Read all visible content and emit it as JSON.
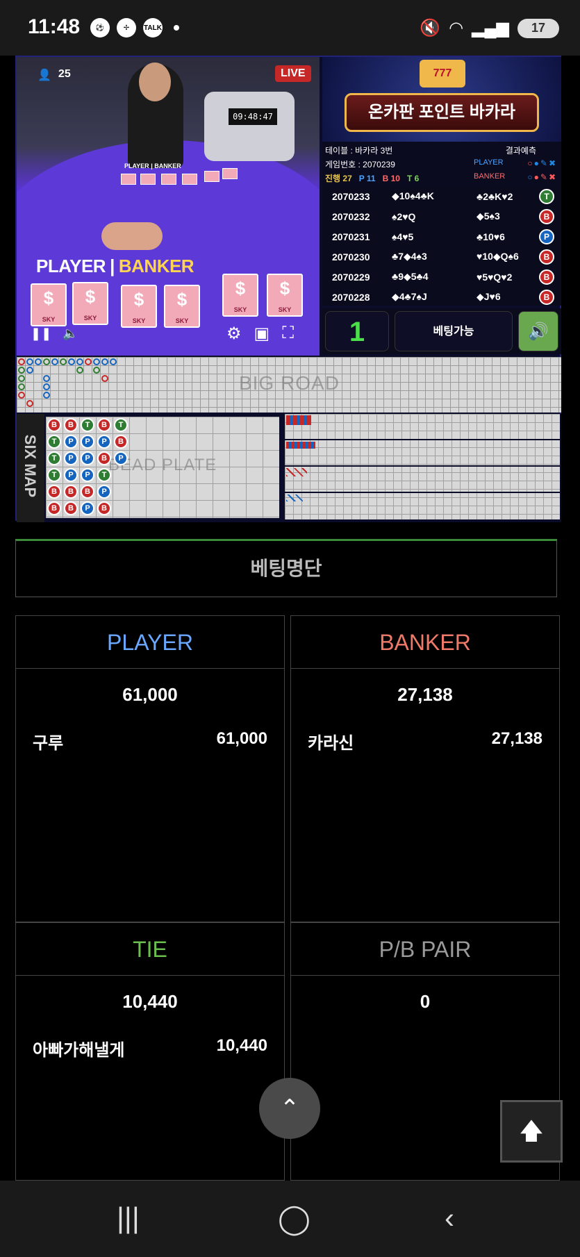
{
  "status_bar": {
    "time": "11:48",
    "left_icons": [
      "soccer-icon",
      "pinwheel-icon",
      "talk-icon"
    ],
    "talk_label": "TALK",
    "battery": "17",
    "right_icons": [
      "mute-icon",
      "wifi-icon",
      "signal-icon",
      "battery-icon"
    ]
  },
  "video": {
    "viewers": "25",
    "live_label": "LIVE",
    "timer": "09:48:47",
    "table_label_player": "PLAYER",
    "table_label_banker": "BANKER",
    "card_brand": "SKY"
  },
  "game": {
    "logo_slot": "777",
    "logo_title": "온카판 포인트 바카라",
    "table_label": "테이블 : 바카라 3번",
    "result_label": "결과예측",
    "game_number_label": "게임번호 : 2070239",
    "player_label": "PLAYER",
    "banker_label": "BANKER",
    "progress_label": "진행 27",
    "p_count": "P 11",
    "b_count": "B 10",
    "t_count": "T 6",
    "history": [
      {
        "no": "2070233",
        "player": "◆10♠4♣K",
        "banker": "♣2♣K♥2",
        "result": "T"
      },
      {
        "no": "2070232",
        "player": "♠2♥Q",
        "banker": "◆5♠3",
        "result": "B"
      },
      {
        "no": "2070231",
        "player": "♠4♥5",
        "banker": "♣10♥6",
        "result": "P"
      },
      {
        "no": "2070230",
        "player": "♣7◆4♠3",
        "banker": "♥10◆Q♠6",
        "result": "B"
      },
      {
        "no": "2070229",
        "player": "♣9◆5♣4",
        "banker": "♥5♥Q♥2",
        "result": "B"
      },
      {
        "no": "2070228",
        "player": "◆4♣7♠J",
        "banker": "◆J♥6",
        "result": "B"
      }
    ],
    "round_count": "1",
    "bet_status": "베팅가능",
    "big_road_label": "BIG ROAD",
    "six_map_label": "SIX MAP",
    "bead_plate_label": "BEAD PLATE",
    "bead_plate": [
      [
        "B",
        "T",
        "T",
        "T",
        "B",
        "B"
      ],
      [
        "B",
        "P",
        "P",
        "P",
        "B",
        "B"
      ],
      [
        "T",
        "P",
        "P",
        "P",
        "B",
        "P"
      ],
      [
        "B",
        "P",
        "B",
        "T",
        "P",
        "B"
      ],
      [
        "T",
        "B",
        "P",
        "",
        "",
        ""
      ]
    ]
  },
  "bet_list": {
    "title": "베팅명단",
    "player": {
      "label": "PLAYER",
      "total": "61,000",
      "entries": [
        {
          "name": "구루",
          "amount": "61,000"
        }
      ]
    },
    "banker": {
      "label": "BANKER",
      "total": "27,138",
      "entries": [
        {
          "name": "카라신",
          "amount": "27,138"
        }
      ]
    },
    "tie": {
      "label": "TIE",
      "total": "10,440",
      "entries": [
        {
          "name": "아빠가해낼게",
          "amount": "10,440"
        }
      ]
    },
    "pair": {
      "label": "P/B PAIR",
      "total": "0",
      "entries": []
    }
  },
  "colors": {
    "player": "#6aa8ff",
    "banker": "#f07a6a",
    "tie": "#6bbf4e",
    "pair": "#9a9a9a",
    "accent_green": "#3a8a3a"
  }
}
